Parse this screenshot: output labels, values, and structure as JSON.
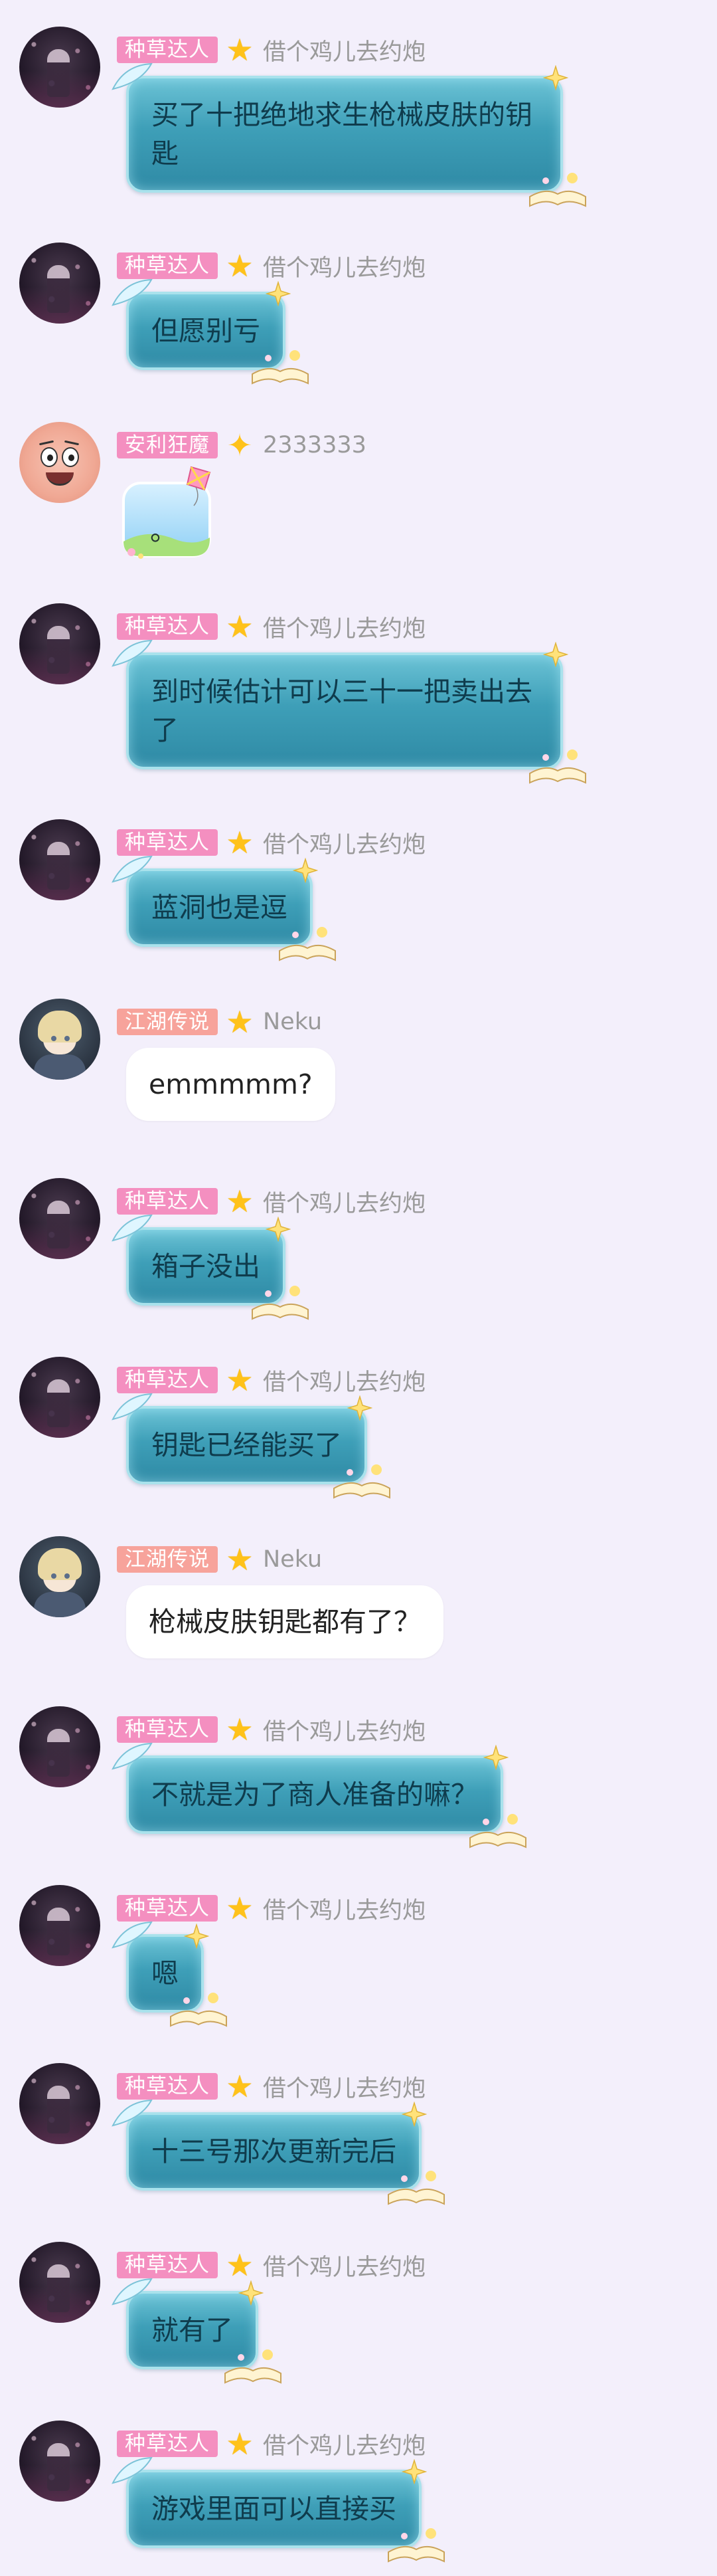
{
  "messages": [
    {
      "badge": "种草达人",
      "user": "借个鸡儿去约炮",
      "text": "买了十把绝地求生枪械皮肤的钥匙"
    },
    {
      "badge": "种草达人",
      "user": "借个鸡儿去约炮",
      "text": "但愿别亏"
    },
    {
      "badge": "安利狂魔",
      "user": "2333333",
      "text": "。"
    },
    {
      "badge": "种草达人",
      "user": "借个鸡儿去约炮",
      "text": "到时候估计可以三十一把卖出去了"
    },
    {
      "badge": "种草达人",
      "user": "借个鸡儿去约炮",
      "text": "蓝洞也是逗"
    },
    {
      "badge": "江湖传说",
      "user": "Neku",
      "text": "emmmmm?"
    },
    {
      "badge": "种草达人",
      "user": "借个鸡儿去约炮",
      "text": "箱子没出"
    },
    {
      "badge": "种草达人",
      "user": "借个鸡儿去约炮",
      "text": "钥匙已经能买了"
    },
    {
      "badge": "江湖传说",
      "user": "Neku",
      "text": "枪械皮肤钥匙都有了？"
    },
    {
      "badge": "种草达人",
      "user": "借个鸡儿去约炮",
      "text": "不就是为了商人准备的嘛？"
    },
    {
      "badge": "种草达人",
      "user": "借个鸡儿去约炮",
      "text": "嗯"
    },
    {
      "badge": "种草达人",
      "user": "借个鸡儿去约炮",
      "text": "十三号那次更新完后"
    },
    {
      "badge": "种草达人",
      "user": "借个鸡儿去约炮",
      "text": "就有了"
    },
    {
      "badge": "种草达人",
      "user": "借个鸡儿去约炮",
      "text": "游戏里面可以直接买"
    }
  ]
}
